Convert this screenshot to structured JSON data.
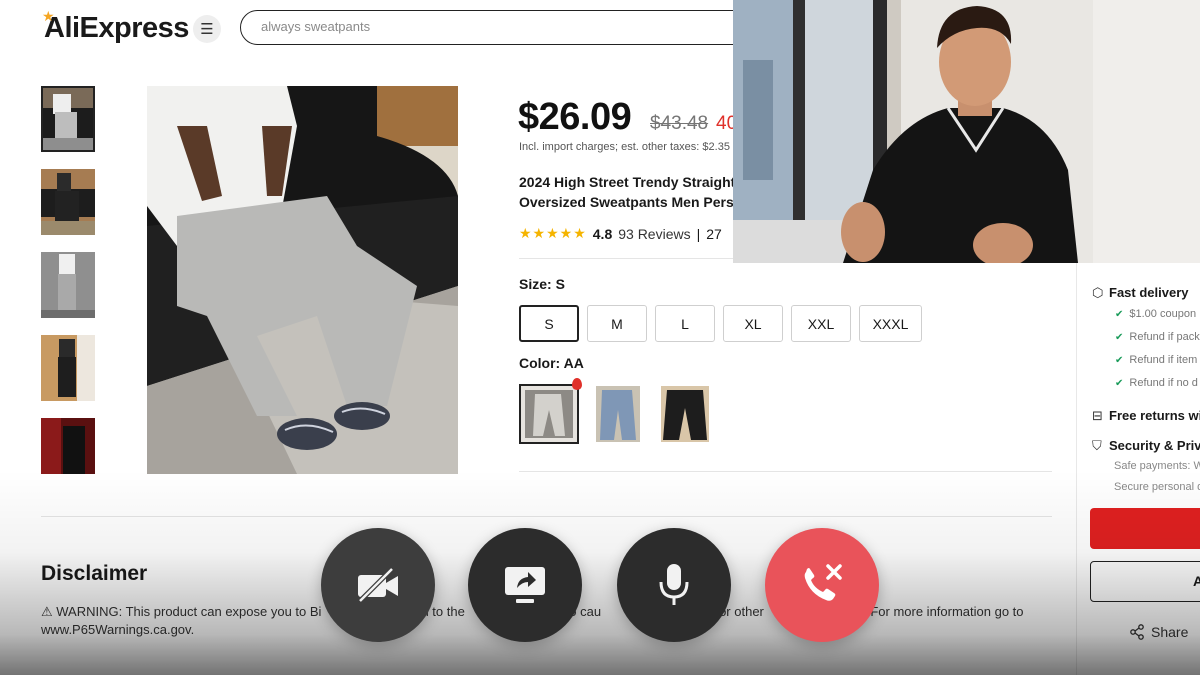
{
  "header": {
    "logo": "AliExpress",
    "search_value": "always sweatpants"
  },
  "product": {
    "price": "$26.09",
    "old_price": "$43.48",
    "discount": "40",
    "tax_note": "Incl. import charges; est. other taxes: $2.35",
    "title_line1": "2024 High Street Trendy Straight",
    "title_line2": "Oversized Sweatpants Men Pers",
    "rating": "4.8",
    "reviews": "93 Reviews",
    "sold_partial": "27",
    "size_label": "Size: S",
    "sizes": [
      "S",
      "M",
      "L",
      "XL",
      "XXL",
      "XXXL"
    ],
    "selected_size": "S",
    "color_label": "Color: AA"
  },
  "side_panel": {
    "fast_delivery": "Fast delivery",
    "checks": [
      "$1.00 coupon",
      "Refund if pack",
      "Refund if item",
      "Refund if no d"
    ],
    "free_returns": "Free returns wi",
    "security": "Security & Priv",
    "safe_payments": "Safe payments: W",
    "secure_personal": "Secure personal d",
    "cart_initial": "A",
    "share": "Share"
  },
  "disclaimer": {
    "title": "Disclaimer",
    "text_part1": "⚠ WARNING: This product can expose you to Bi",
    "text_part2": "n to the",
    "text_part3": "a to cau",
    "text_part4": "or other",
    "text_part5": "n. For more information go to",
    "text_line2": "www.P65Warnings.ca.gov."
  },
  "call_controls": {
    "buttons": [
      "camera-off",
      "share-screen",
      "microphone",
      "end-call"
    ]
  },
  "colors": {
    "price_red": "#e0302a",
    "buy_red": "#e02020",
    "end_call": "#e9535a",
    "star": "#f5b400",
    "check": "#1a9b5a"
  }
}
